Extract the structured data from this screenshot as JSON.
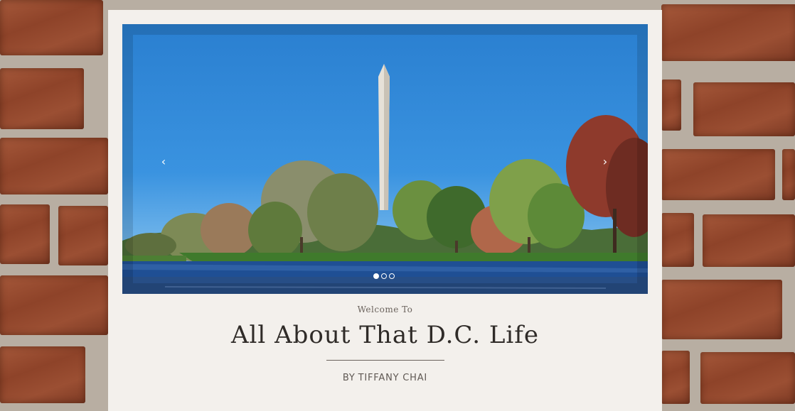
{
  "hero": {
    "prev_arrow": "‹",
    "next_arrow": "›",
    "slide_count": 3,
    "active_slide": 1
  },
  "header": {
    "welcome": "Welcome To",
    "title": "All About That D.C. Life",
    "by_label": "BY",
    "author": "TIFFANY CHAI"
  },
  "colors": {
    "sky": "#2a7fd0",
    "panel": "#f7f4f0",
    "brick": "#9b4f33",
    "title_text": "#2f2b28"
  }
}
